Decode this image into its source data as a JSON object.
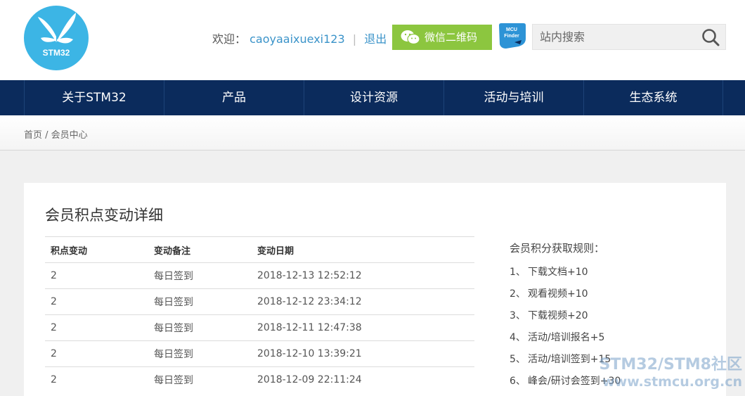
{
  "logo": {
    "text": "STM32"
  },
  "header": {
    "welcome_label": "欢迎：",
    "username": "caoyaaixuexi123",
    "separator": "|",
    "logout_label": "退出",
    "wechat_label": "微信二维码",
    "mcu_finder_line1": "MCU",
    "mcu_finder_line2": "Finder",
    "search_placeholder": "站内搜索"
  },
  "nav": {
    "items": [
      {
        "label": "关于STM32"
      },
      {
        "label": "产品"
      },
      {
        "label": "设计资源"
      },
      {
        "label": "活动与培训"
      },
      {
        "label": "生态系统"
      }
    ]
  },
  "breadcrumb": {
    "home": "首页",
    "divider": " / ",
    "current": "会员中心"
  },
  "main": {
    "title": "会员积点变动详细",
    "table": {
      "headers": [
        "积点变动",
        "变动备注",
        "变动日期"
      ],
      "rows": [
        [
          "2",
          "每日签到",
          "2018-12-13 12:52:12"
        ],
        [
          "2",
          "每日签到",
          "2018-12-12 23:34:12"
        ],
        [
          "2",
          "每日签到",
          "2018-12-11 12:47:38"
        ],
        [
          "2",
          "每日签到",
          "2018-12-10 13:39:21"
        ],
        [
          "2",
          "每日签到",
          "2018-12-09 22:11:24"
        ]
      ]
    },
    "rules": {
      "title": "会员积分获取规则：",
      "items": [
        {
          "num": "1、",
          "text": "下载文档+10"
        },
        {
          "num": "2、",
          "text": "观看视频+10"
        },
        {
          "num": "3、",
          "text": "下载视频+20"
        },
        {
          "num": "4、",
          "text": "活动/培训报名+5"
        },
        {
          "num": "5、",
          "text": "活动/培训签到+15"
        },
        {
          "num": "6、",
          "text": "峰会/研讨会签到+30"
        }
      ]
    }
  },
  "watermark": {
    "line1": "STM32/STM8社区",
    "line2": "www.stmcu.org.cn"
  },
  "colors": {
    "nav_bg": "#0b2b5c",
    "logo_bg": "#3cb5e5",
    "wechat_bg": "#8cc63f",
    "link": "#3a93c9"
  }
}
